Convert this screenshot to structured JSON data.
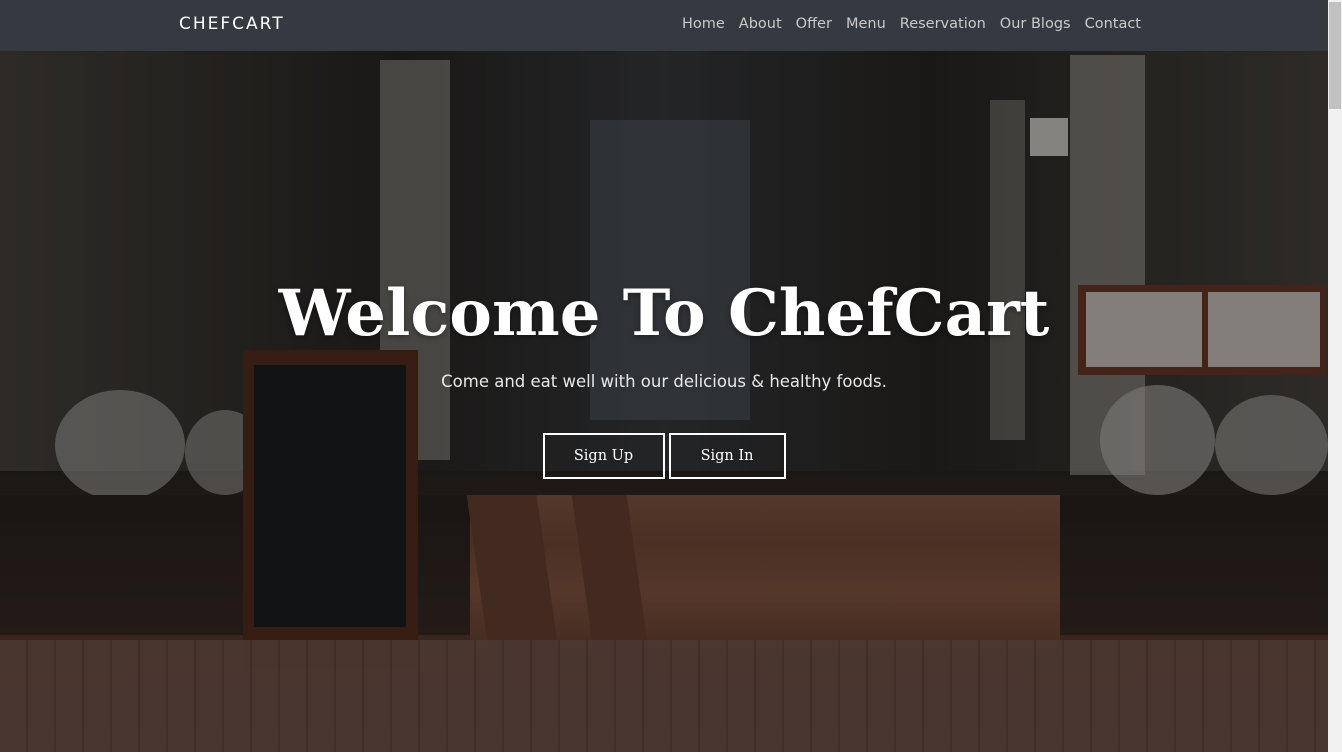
{
  "navbar": {
    "brand": "CHEFCART",
    "links": [
      "Home",
      "About",
      "Offer",
      "Menu",
      "Reservation",
      "Our Blogs",
      "Contact"
    ]
  },
  "hero": {
    "title": "Welcome To ChefCart",
    "subtitle": "Come and eat well with our delicious & healthy foods.",
    "signup_label": "Sign Up",
    "signin_label": "Sign In"
  },
  "colors": {
    "navbar_bg": "#343a40",
    "nav_link": "#c9cacb",
    "brand_text": "#ffffff",
    "button_border": "#ffffff"
  }
}
